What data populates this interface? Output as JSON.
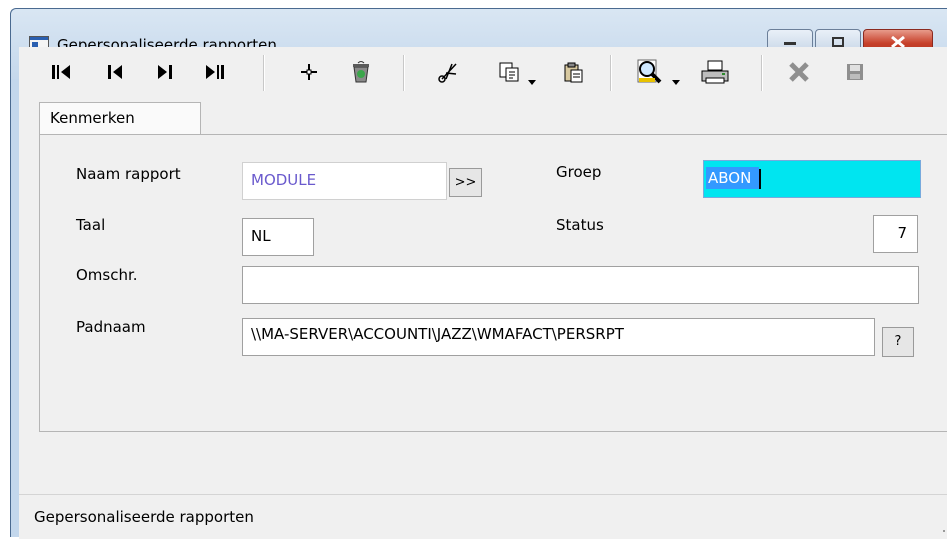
{
  "window": {
    "title": "Gepersonaliseerde rapporten",
    "controls": [
      "minimize-icon",
      "maximize-icon",
      "close-icon"
    ]
  },
  "toolbar": {
    "buttons": [
      {
        "name": "first-record",
        "icon": "first-record-icon"
      },
      {
        "name": "previous-record",
        "icon": "previous-record-icon"
      },
      {
        "name": "next-record",
        "icon": "next-record-icon"
      },
      {
        "name": "last-record",
        "icon": "last-record-icon"
      },
      {
        "name": "add",
        "icon": "plus-icon"
      },
      {
        "name": "delete",
        "icon": "recycle-bin-icon"
      },
      {
        "name": "cut",
        "icon": "scissors-icon"
      },
      {
        "name": "copy",
        "icon": "copy-icon",
        "dropdown": true
      },
      {
        "name": "paste",
        "icon": "clipboard-icon"
      },
      {
        "name": "search",
        "icon": "magnifier-icon",
        "dropdown": true
      },
      {
        "name": "print",
        "icon": "printer-icon"
      },
      {
        "name": "cancel",
        "icon": "x-icon",
        "disabled": true
      },
      {
        "name": "save",
        "icon": "floppy-icon",
        "disabled": true
      }
    ]
  },
  "tabs": [
    {
      "label": "Kenmerken",
      "active": true
    }
  ],
  "form": {
    "naam_rapport": {
      "label": "Naam rapport",
      "value": "MODULE",
      "browse_label": ">>"
    },
    "groep": {
      "label": "Groep",
      "value": "ABON"
    },
    "taal": {
      "label": "Taal",
      "value": "NL"
    },
    "status": {
      "label": "Status",
      "value": "7"
    },
    "omschr": {
      "label": "Omschr.",
      "value": ""
    },
    "padnaam": {
      "label": "Padnaam",
      "value": "\\\\MA-SERVER\\ACCOUNTI\\JAZZ\\WMAFACT\\PERSRPT",
      "help_label": "?"
    }
  },
  "statusbar": {
    "text": "Gepersonaliseerde rapporten"
  },
  "colors": {
    "accent_field": "#00e5f0",
    "selection": "#3399ff",
    "readonly_text": "#6a5acd",
    "frame": "#c3d7ec"
  }
}
